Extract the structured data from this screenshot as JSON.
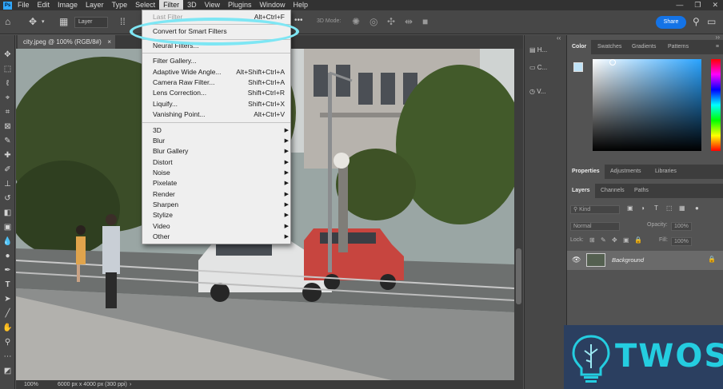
{
  "menubar": {
    "items": [
      "File",
      "Edit",
      "Image",
      "Layer",
      "Type",
      "Select",
      "Filter",
      "3D",
      "View",
      "Plugins",
      "Window",
      "Help"
    ],
    "active": "Filter"
  },
  "options": {
    "layer_select": "Layer",
    "mode3d": "3D Mode:",
    "share": "Share"
  },
  "document": {
    "tab_title": "city.jpeg @ 100% (RGB/8#)",
    "zoom": "100%",
    "dimensions": "6000 px x 4000 px (300 ppi)"
  },
  "filter_menu": {
    "items": [
      {
        "label": "Last Filter",
        "shortcut": "Alt+Ctrl+F",
        "disabled": true
      },
      {
        "label": "Convert for Smart Filters",
        "shortcut": ""
      },
      {
        "label": "Neural Filters...",
        "shortcut": ""
      },
      {
        "label": "Filter Gallery...",
        "shortcut": ""
      },
      {
        "label": "Adaptive Wide Angle...",
        "shortcut": "Alt+Shift+Ctrl+A"
      },
      {
        "label": "Camera Raw Filter...",
        "shortcut": "Shift+Ctrl+A"
      },
      {
        "label": "Lens Correction...",
        "shortcut": "Shift+Ctrl+R"
      },
      {
        "label": "Liquify...",
        "shortcut": "Shift+Ctrl+X"
      },
      {
        "label": "Vanishing Point...",
        "shortcut": "Alt+Ctrl+V"
      },
      {
        "label": "3D",
        "submenu": true
      },
      {
        "label": "Blur",
        "submenu": true
      },
      {
        "label": "Blur Gallery",
        "submenu": true
      },
      {
        "label": "Distort",
        "submenu": true
      },
      {
        "label": "Noise",
        "submenu": true
      },
      {
        "label": "Pixelate",
        "submenu": true
      },
      {
        "label": "Render",
        "submenu": true
      },
      {
        "label": "Sharpen",
        "submenu": true
      },
      {
        "label": "Stylize",
        "submenu": true
      },
      {
        "label": "Video",
        "submenu": true
      },
      {
        "label": "Other",
        "submenu": true
      }
    ]
  },
  "mini_panel": {
    "items": [
      "H...",
      "C...",
      "V..."
    ]
  },
  "color_panel": {
    "tabs": [
      "Color",
      "Swatches",
      "Gradients",
      "Patterns"
    ]
  },
  "properties_panel": {
    "tabs": [
      "Properties",
      "Adjustments",
      "Libraries"
    ]
  },
  "layers_panel": {
    "tabs": [
      "Layers",
      "Channels",
      "Paths"
    ],
    "kind": "Kind",
    "blend_mode": "Normal",
    "opacity_label": "Opacity:",
    "opacity_value": "100%",
    "lock_label": "Lock:",
    "fill_label": "Fill:",
    "fill_value": "100%",
    "layer_name": "Background"
  },
  "watermark": {
    "text": "TWOS"
  },
  "colors": {
    "accent": "#1473e6",
    "highlight_ring": "#7ee6f4",
    "watermark_text": "#24cde0",
    "watermark_bg": "#2b3f60"
  }
}
